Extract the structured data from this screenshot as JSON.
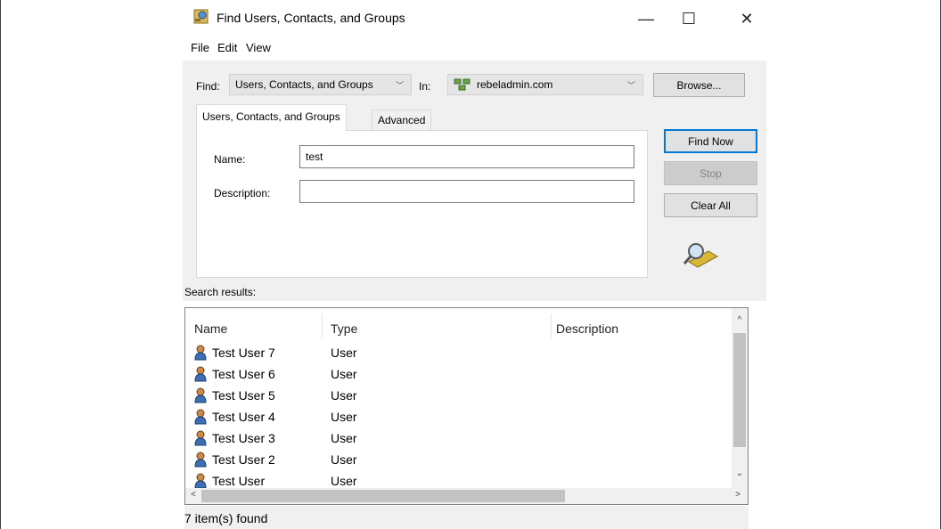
{
  "window": {
    "title": "Find Users, Contacts, and Groups",
    "controls": {
      "minimize": "—",
      "maximize": "☐",
      "close": "✕"
    }
  },
  "menu": [
    "File",
    "Edit",
    "View"
  ],
  "find_bar": {
    "find_label": "Find:",
    "find_value": "Users, Contacts, and Groups",
    "in_label": "In:",
    "in_value": "rebeladmin.com",
    "browse_button": "Browse..."
  },
  "tabs": [
    "Users, Contacts, and Groups",
    "Advanced"
  ],
  "form": {
    "name_label": "Name:",
    "name_value": "test",
    "description_label": "Description:",
    "description_value": ""
  },
  "actions": {
    "find_now": "Find Now",
    "stop": "Stop",
    "clear_all": "Clear All"
  },
  "results": {
    "label": "Search results:",
    "columns": [
      "Name",
      "Type",
      "Description"
    ],
    "rows": [
      {
        "name": "Test User 7",
        "type": "User",
        "description": ""
      },
      {
        "name": "Test User 6",
        "type": "User",
        "description": ""
      },
      {
        "name": "Test User 5",
        "type": "User",
        "description": ""
      },
      {
        "name": "Test User 4",
        "type": "User",
        "description": ""
      },
      {
        "name": "Test User 3",
        "type": "User",
        "description": ""
      },
      {
        "name": "Test User 2",
        "type": "User",
        "description": ""
      },
      {
        "name": "Test User",
        "type": "User",
        "description": ""
      }
    ]
  },
  "status": "7 item(s) found",
  "colors": {
    "accent": "#0078d7",
    "dialog_bg": "#f0f0f0"
  }
}
